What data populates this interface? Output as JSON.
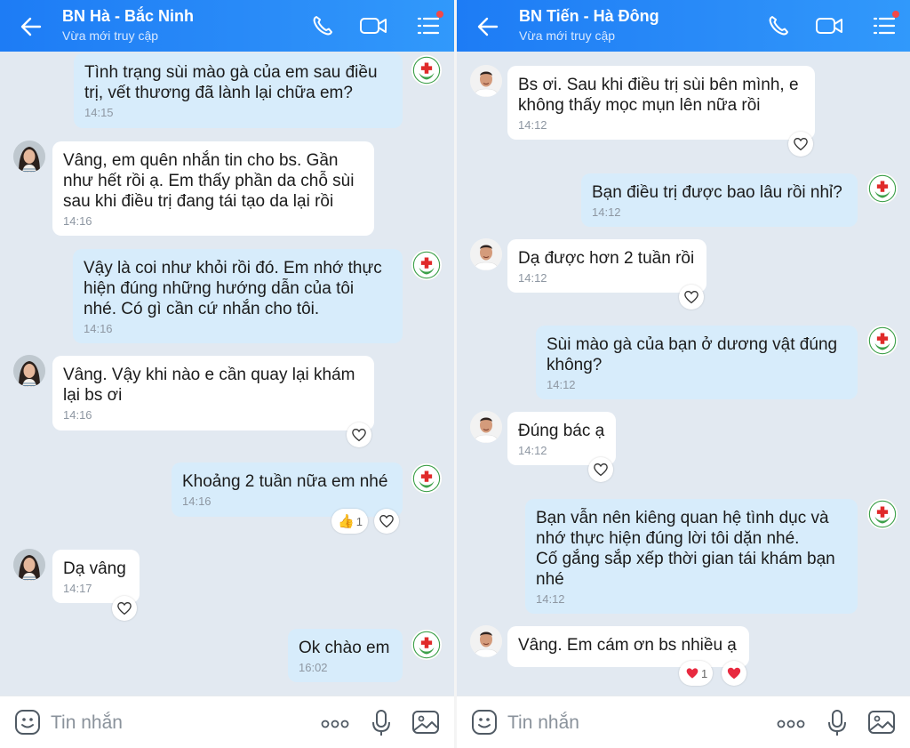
{
  "colors": {
    "header_gradient_start": "#1d7cf5",
    "header_gradient_end": "#3199fb",
    "chat_background": "#e2e9f1",
    "outgoing_bubble": "#d7ecfb",
    "incoming_bubble": "#ffffff",
    "notification_dot": "#f34848"
  },
  "left_chat": {
    "header": {
      "title": "BN Hà - Bắc Ninh",
      "status": "Vừa mới truy cập"
    },
    "messages": [
      {
        "text": "Tình trạng sùi mào gà của em sau điều\ntrị, vết thương đã lành lại chữa em?",
        "time": "14:15"
      },
      {
        "text": "Vâng, em quên nhắn tin cho bs. Gần\nnhư hết rồi ạ. Em thấy phần da chỗ sùi\nsau khi điều trị đang tái tạo da lại rồi",
        "time": "14:16"
      },
      {
        "text": "Vậy là coi như khỏi rồi đó. Em nhớ thực\nhiện đúng những hướng dẫn của tôi\nnhé. Có gì cần cứ nhắn cho tôi.",
        "time": "14:16"
      },
      {
        "text": "Vâng. Vậy khi nào e cần quay lại khám\nlại bs ơi",
        "time": "14:16"
      },
      {
        "text": "Khoảng 2 tuần nữa em nhé",
        "time": "14:16",
        "reaction_count": "1",
        "reaction_icon": "thumbs-up-icon"
      },
      {
        "text": "Dạ vâng",
        "time": "14:17"
      },
      {
        "text": "Ok chào em",
        "time": "16:02"
      }
    ],
    "input": {
      "placeholder": "Tin nhắn"
    }
  },
  "right_chat": {
    "header": {
      "title": "BN Tiến - Hà Đông",
      "status": "Vừa mới truy cập"
    },
    "messages": [
      {
        "text": "Bs ơi. Sau khi điều trị sùi bên mình, e\nkhông thấy mọc mụn lên nữa rồi",
        "time": "14:12"
      },
      {
        "text": "Bạn điều trị được bao lâu rồi nhỉ?",
        "time": "14:12"
      },
      {
        "text": "Dạ được hơn 2 tuần rồi",
        "time": "14:12"
      },
      {
        "text": "Sùi mào gà của bạn ở dương vật đúng\nkhông?",
        "time": "14:12"
      },
      {
        "text": "Đúng bác ạ",
        "time": "14:12"
      },
      {
        "text": "Bạn vẫn nên kiêng quan hệ tình dục và\nnhớ thực hiện đúng lời tôi dặn nhé.\nCố gắng sắp xếp thời gian tái khám bạn\nnhé",
        "time": "14:12"
      },
      {
        "text": "Vâng. Em cám ơn bs nhiều ạ",
        "time": "",
        "reaction_count": "1",
        "reaction_icon": "red-heart-icon"
      }
    ],
    "input": {
      "placeholder": "Tin nhắn"
    }
  }
}
